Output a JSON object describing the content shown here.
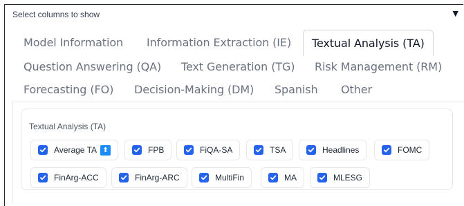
{
  "header": {
    "label": "Select columns to show",
    "caret": "▼"
  },
  "tabs": [
    {
      "label": "Model Information"
    },
    {
      "label": "Information Extraction (IE)"
    },
    {
      "label": "Textual Analysis (TA)",
      "active": true
    },
    {
      "label": "Question Answering (QA)"
    },
    {
      "label": "Text Generation (TG)"
    },
    {
      "label": "Risk Management (RM)"
    },
    {
      "label": "Forecasting (FO)"
    },
    {
      "label": "Decision-Making (DM)"
    },
    {
      "label": "Spanish"
    },
    {
      "label": "Other"
    }
  ],
  "group": {
    "title": "Textual Analysis (TA)",
    "options": [
      {
        "label": "Average TA",
        "checked": true,
        "badge": "⬆"
      },
      {
        "label": "FPB",
        "checked": true
      },
      {
        "label": "FiQA-SA",
        "checked": true
      },
      {
        "label": "TSA",
        "checked": true
      },
      {
        "label": "Headlines",
        "checked": true
      },
      {
        "label": "FOMC",
        "checked": true
      },
      {
        "label": "FinArg-ACC",
        "checked": true
      },
      {
        "label": "FinArg-ARC",
        "checked": true
      },
      {
        "label": "MultiFin",
        "checked": true
      },
      {
        "label": "MA",
        "checked": true
      },
      {
        "label": "MLESG",
        "checked": true
      }
    ]
  },
  "colors": {
    "checkbox": "#2563eb",
    "badge": "#1d8cf8"
  }
}
